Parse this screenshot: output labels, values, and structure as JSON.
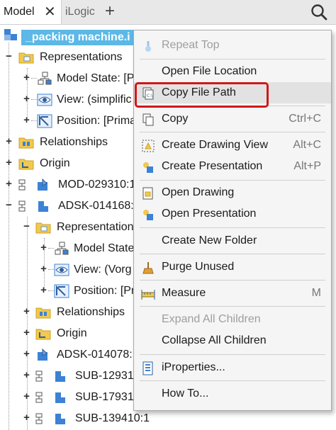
{
  "tabs": {
    "model": "Model",
    "ilogic": "iLogic",
    "close_glyph": "✕",
    "add_glyph": "+"
  },
  "tree": {
    "root": "_packing machine.i",
    "representations": "Representations",
    "model_state": "Model State: [P",
    "view": "View: (simplific",
    "position": "Position: [Prima",
    "relationships": "Relationships",
    "origin": "Origin",
    "mod": "MOD-029310:1",
    "adsk1": "ADSK-014168:",
    "sub_representations": "Representations",
    "sub_model_state": "Model State",
    "sub_view": "View: (Vorg",
    "sub_position": "Position: [Pr",
    "sub_relationships": "Relationships",
    "sub_origin": "Origin",
    "adsk2": "ADSK-014078:",
    "sub1": "SUB-12931(",
    "sub2": "SUB-17931(",
    "sub3": "SUB-139410:1"
  },
  "menu": {
    "repeat_top": "Repeat Top",
    "open_file_location": "Open File Location",
    "copy_file_path": "Copy File Path",
    "copy": "Copy",
    "copy_shortcut": "Ctrl+C",
    "create_drawing_view": "Create Drawing View",
    "create_drawing_view_shortcut": "Alt+C",
    "create_presentation": "Create Presentation",
    "create_presentation_shortcut": "Alt+P",
    "open_drawing": "Open Drawing",
    "open_presentation": "Open Presentation",
    "create_new_folder": "Create New Folder",
    "purge_unused": "Purge Unused",
    "measure": "Measure",
    "measure_shortcut": "M",
    "expand_all_children": "Expand All Children",
    "collapse_all_children": "Collapse All Children",
    "iproperties": "iProperties...",
    "how_to": "How To..."
  },
  "colors": {
    "root_highlight": "#5cb8e6",
    "callout_border": "#d01818",
    "menu_background": "#f5f5f5",
    "folder_yellow": "#f2c94c",
    "assembly_blue": "#3c82d6"
  }
}
